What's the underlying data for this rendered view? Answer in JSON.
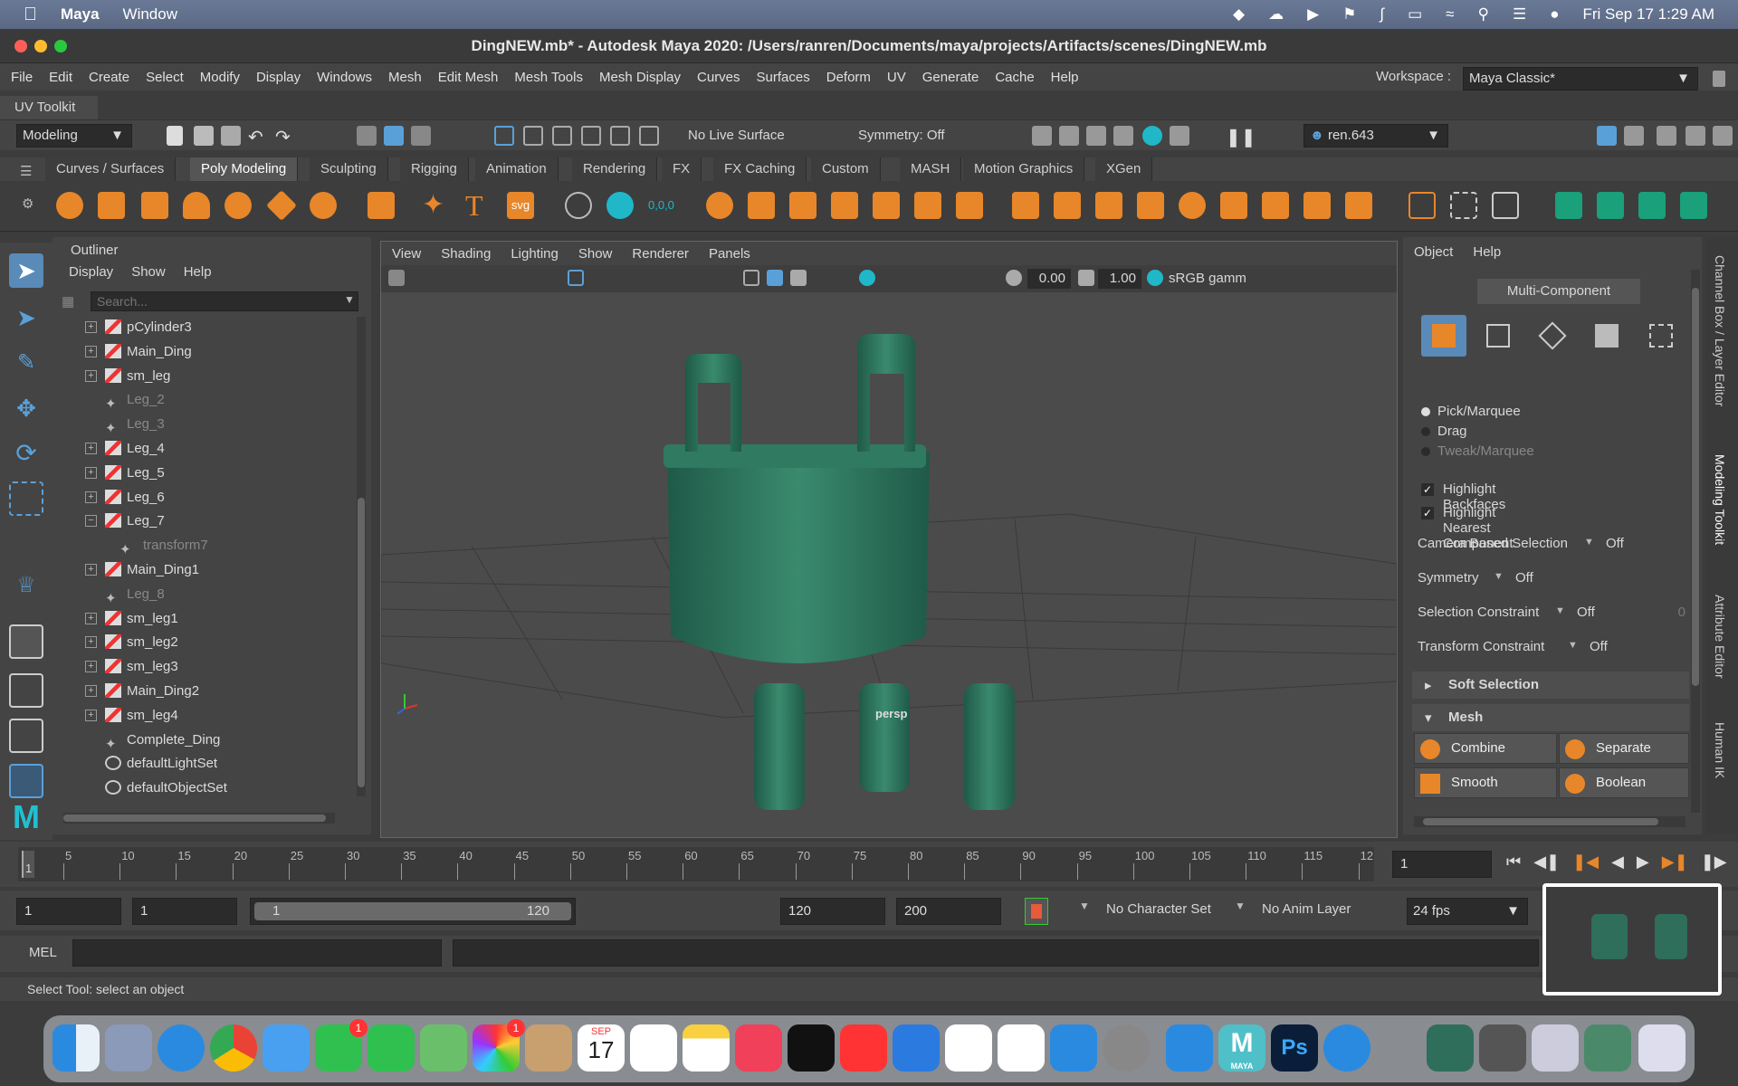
{
  "macbar": {
    "app": "Maya",
    "window_menu": "Window",
    "datetime": "Fri Sep 17  1:29 AM"
  },
  "window_title": "DingNEW.mb* - Autodesk Maya 2020: /Users/ranren/Documents/maya/projects/Artifacts/scenes/DingNEW.mb",
  "menus": [
    "File",
    "Edit",
    "Create",
    "Select",
    "Modify",
    "Display",
    "Windows",
    "Mesh",
    "Edit Mesh",
    "Mesh Tools",
    "Mesh Display",
    "Curves",
    "Surfaces",
    "Deform",
    "UV",
    "Generate",
    "Cache",
    "Help"
  ],
  "workspace": {
    "label": "Workspace :",
    "value": "Maya Classic*"
  },
  "uv_toolkit": "UV Toolkit",
  "status": {
    "menu_set": "Modeling",
    "live_surface": "No Live Surface",
    "symmetry": "Symmetry: Off",
    "user": "ren.643"
  },
  "shelf_tabs": [
    "Curves / Surfaces",
    "Poly Modeling",
    "Sculpting",
    "Rigging",
    "Animation",
    "Rendering",
    "FX",
    "FX Caching",
    "Custom",
    "MASH",
    "Motion Graphics",
    "XGen"
  ],
  "outliner": {
    "title": "Outliner",
    "menus": [
      "Display",
      "Show",
      "Help"
    ],
    "search_placeholder": "Search...",
    "items": [
      "pCylinder3",
      "Main_Ding",
      "sm_leg",
      "Leg_2",
      "Leg_3",
      "Leg_4",
      "Leg_5",
      "Leg_6",
      "Leg_7",
      "transform7",
      "Main_Ding1",
      "Leg_8",
      "sm_leg1",
      "sm_leg2",
      "sm_leg3",
      "Main_Ding2",
      "sm_leg4",
      "Complete_Ding",
      "defaultLightSet",
      "defaultObjectSet"
    ]
  },
  "viewport": {
    "menus": [
      "View",
      "Shading",
      "Lighting",
      "Show",
      "Renderer",
      "Panels"
    ],
    "exposure": "0.00",
    "gamma": "1.00",
    "colorspace": "sRGB gamm",
    "camera": "persp"
  },
  "modeling_toolkit": {
    "menus": [
      "Object",
      "Help"
    ],
    "mode": "Multi-Component",
    "pick_options": [
      "Pick/Marquee",
      "Drag",
      "Tweak/Marquee"
    ],
    "checks": [
      "Highlight Backfaces",
      "Highlight Nearest Component"
    ],
    "settings": [
      {
        "label": "Camera Based Selection",
        "value": "Off"
      },
      {
        "label": "Symmetry",
        "value": "Off"
      },
      {
        "label": "Selection Constraint",
        "value": "Off",
        "extra": "0"
      },
      {
        "label": "Transform Constraint",
        "value": "Off"
      }
    ],
    "soft_selection": "Soft Selection",
    "mesh_section": "Mesh",
    "mesh_buttons": [
      "Combine",
      "Separate",
      "Smooth",
      "Boolean"
    ]
  },
  "side_tabs": [
    "Channel Box / Layer Editor",
    "Modeling Toolkit",
    "Attribute Editor",
    "Human IK"
  ],
  "timeline": {
    "ticks": [
      "5",
      "10",
      "15",
      "20",
      "25",
      "30",
      "35",
      "40",
      "45",
      "50",
      "55",
      "60",
      "65",
      "70",
      "75",
      "80",
      "85",
      "90",
      "95",
      "100",
      "105",
      "110",
      "115",
      "12"
    ],
    "first_frame": "1",
    "current_frame": "1"
  },
  "range": {
    "start": "1",
    "anim_start": "1",
    "slider_start": "1",
    "slider_end": "120",
    "anim_end": "120",
    "end": "200",
    "character_set": "No Character Set",
    "anim_layer": "No Anim Layer",
    "fps": "24 fps"
  },
  "command": {
    "mel": "MEL"
  },
  "help_line": "Select Tool: select an object",
  "dock": {
    "calendar_month": "SEP",
    "calendar_day": "17",
    "facetime_badge": "1",
    "photos_badge": "1",
    "maya_label": "MAYA"
  },
  "colors": {
    "accent": "#e8862a",
    "blue": "#5aa0d8",
    "ding_green": "#2e6e5a"
  }
}
